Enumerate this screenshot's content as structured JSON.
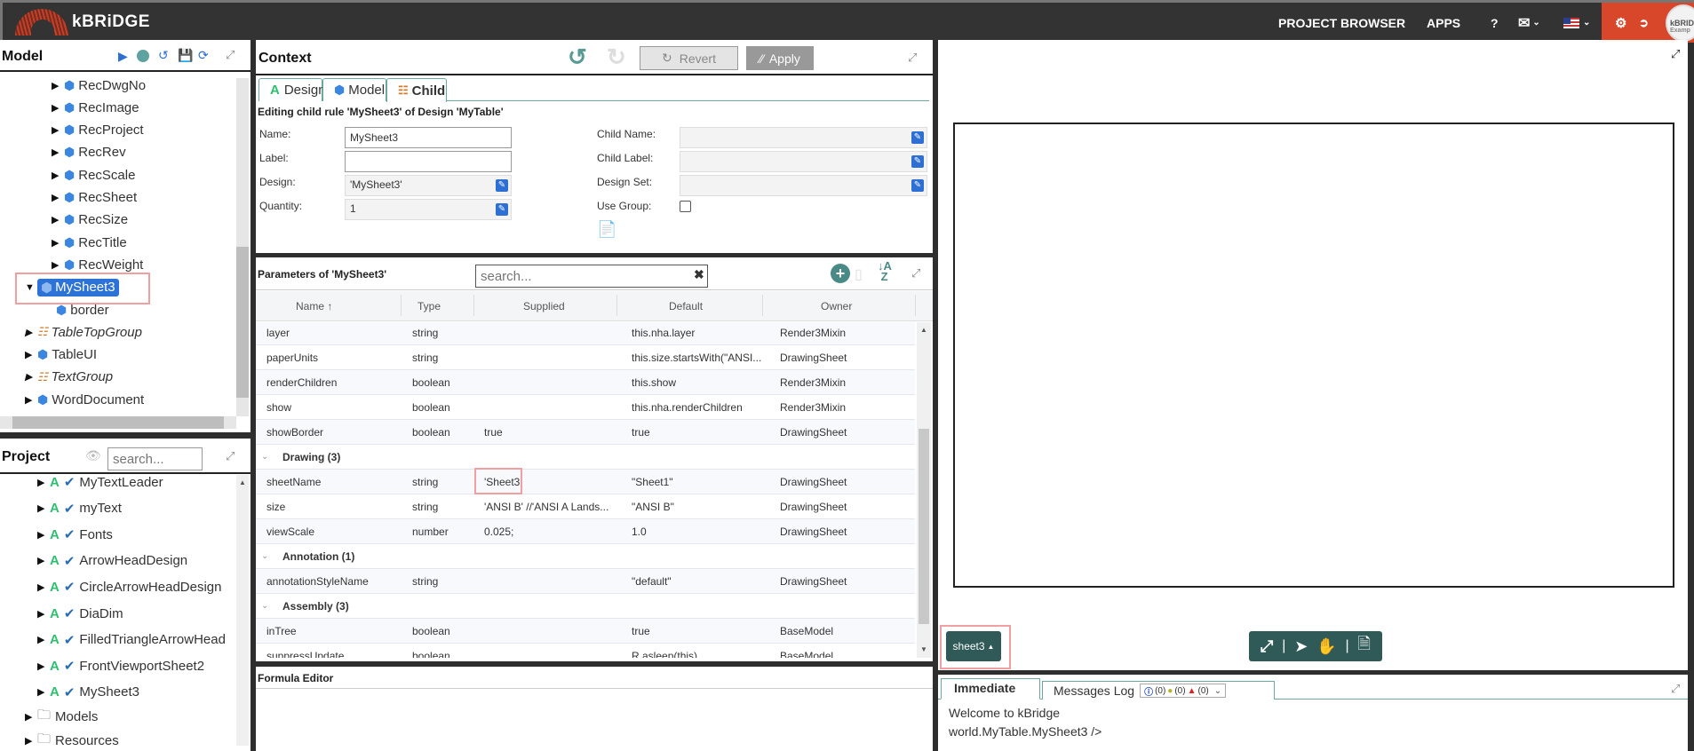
{
  "topbar": {
    "logo_text": "kBRiDGE",
    "nav": {
      "project_browser": "PROJECT BROWSER",
      "apps": "APPS",
      "help": "?"
    },
    "avatar_text_1": "kBRID",
    "avatar_text_2": "Examp"
  },
  "model_panel": {
    "title": "Model",
    "tree": [
      {
        "label": "RecDwgNo",
        "icon": "cube"
      },
      {
        "label": "RecImage",
        "icon": "cube"
      },
      {
        "label": "RecProject",
        "icon": "cube"
      },
      {
        "label": "RecRev",
        "icon": "cube"
      },
      {
        "label": "RecScale",
        "icon": "cube"
      },
      {
        "label": "RecSheet",
        "icon": "cube"
      },
      {
        "label": "RecSize",
        "icon": "cube"
      },
      {
        "label": "RecTitle",
        "icon": "cube"
      },
      {
        "label": "RecWeight",
        "icon": "cube"
      }
    ],
    "selected": {
      "label": "MySheet3",
      "icon": "cube"
    },
    "child": {
      "label": "border",
      "icon": "cube"
    },
    "tree_after": [
      {
        "label": "TableTopGroup",
        "icon": "org-chart",
        "italic": true
      },
      {
        "label": "TableUI",
        "icon": "cube"
      },
      {
        "label": "TextGroup",
        "icon": "org-chart",
        "italic": true
      },
      {
        "label": "WordDocument",
        "icon": "cube"
      }
    ]
  },
  "project_panel": {
    "title": "Project",
    "search_placeholder": "search...",
    "items": [
      {
        "label": "MyTextLeader"
      },
      {
        "label": "myText"
      },
      {
        "label": "Fonts"
      },
      {
        "label": "ArrowHeadDesign"
      },
      {
        "label": "CircleArrowHeadDesign"
      },
      {
        "label": "DiaDim"
      },
      {
        "label": "FilledTriangleArrowHead"
      },
      {
        "label": "FrontViewportSheet2"
      },
      {
        "label": "MySheet3"
      }
    ],
    "folders": [
      {
        "label": "Models"
      },
      {
        "label": "Resources"
      }
    ]
  },
  "context_panel": {
    "title": "Context",
    "revert_label": "Revert",
    "apply_label": "Apply",
    "tabs": [
      {
        "label": "Design",
        "active": false
      },
      {
        "label": "Model",
        "active": false
      },
      {
        "label": "Child",
        "active": true
      }
    ],
    "subtitle": "Editing child rule 'MySheet3' of Design 'MyTable'",
    "fields": {
      "name_label": "Name:",
      "name_value": "MySheet3",
      "label_label": "Label:",
      "label_value": "",
      "design_label": "Design:",
      "design_value": "'MySheet3'",
      "quantity_label": "Quantity:",
      "quantity_value": "1",
      "child_name_label": "Child Name:",
      "child_name_value": "",
      "child_label_label": "Child Label:",
      "child_label_value": "",
      "design_set_label": "Design Set:",
      "design_set_value": "",
      "use_group_label": "Use Group:",
      "use_group_checked": false
    }
  },
  "parameters_panel": {
    "title": "Parameters of 'MySheet3'",
    "search_placeholder": "search...",
    "columns": [
      "Name ↑",
      "Type",
      "Supplied",
      "Default",
      "Owner"
    ],
    "rows": [
      {
        "kind": "row",
        "name": "layer",
        "type": "string",
        "supplied": "",
        "default": "this.nha.layer",
        "owner": "Render3Mixin"
      },
      {
        "kind": "row",
        "name": "paperUnits",
        "type": "string",
        "supplied": "",
        "default": "this.size.startsWith(\"ANSI...",
        "owner": "DrawingSheet"
      },
      {
        "kind": "row",
        "name": "renderChildren",
        "type": "boolean",
        "supplied": "",
        "default": "this.show",
        "owner": "Render3Mixin"
      },
      {
        "kind": "row",
        "name": "show",
        "type": "boolean",
        "supplied": "",
        "default": "this.nha.renderChildren",
        "owner": "Render3Mixin"
      },
      {
        "kind": "row",
        "name": "showBorder",
        "type": "boolean",
        "supplied": "true",
        "default": "true",
        "owner": "DrawingSheet"
      },
      {
        "kind": "group",
        "name": "Drawing (3)"
      },
      {
        "kind": "row",
        "name": "sheetName",
        "type": "string",
        "supplied": "'Sheet3'",
        "default": "\"Sheet1\"",
        "owner": "DrawingSheet",
        "highlight": true
      },
      {
        "kind": "row",
        "name": "size",
        "type": "string",
        "supplied": "'ANSI B' //'ANSI A Lands...",
        "default": "\"ANSI B\"",
        "owner": "DrawingSheet"
      },
      {
        "kind": "row",
        "name": "viewScale",
        "type": "number",
        "supplied": "0.025;",
        "default": "1.0",
        "owner": "DrawingSheet"
      },
      {
        "kind": "group",
        "name": "Annotation (1)"
      },
      {
        "kind": "row",
        "name": "annotationStyleName",
        "type": "string",
        "supplied": "",
        "default": "\"default\"",
        "owner": "DrawingSheet"
      },
      {
        "kind": "group",
        "name": "Assembly (3)"
      },
      {
        "kind": "row",
        "name": "inTree",
        "type": "boolean",
        "supplied": "",
        "default": "true",
        "owner": "BaseModel"
      },
      {
        "kind": "row",
        "name": "suppressUpdate",
        "type": "boolean",
        "supplied": "",
        "default": "R.asleep(this)",
        "owner": "BaseModel"
      }
    ]
  },
  "formula_editor": {
    "title": "Formula Editor"
  },
  "viewport": {
    "sheet_button_label": "sheet3"
  },
  "console": {
    "tabs": [
      {
        "label": "Immediate",
        "active": true
      },
      {
        "label": "Messages Log",
        "active": false
      }
    ],
    "counts": {
      "info": "(0)",
      "warning": "(0)",
      "error": "(0)"
    },
    "lines": [
      "Welcome to kBridge",
      "world.MyTable.MySheet3 />"
    ]
  },
  "colors": {
    "accent": "#2d6fd2",
    "header": "#333333",
    "orange": "#d9472b",
    "teal_dark": "#2f5a57",
    "highlight_box": "#f0a0a0"
  }
}
